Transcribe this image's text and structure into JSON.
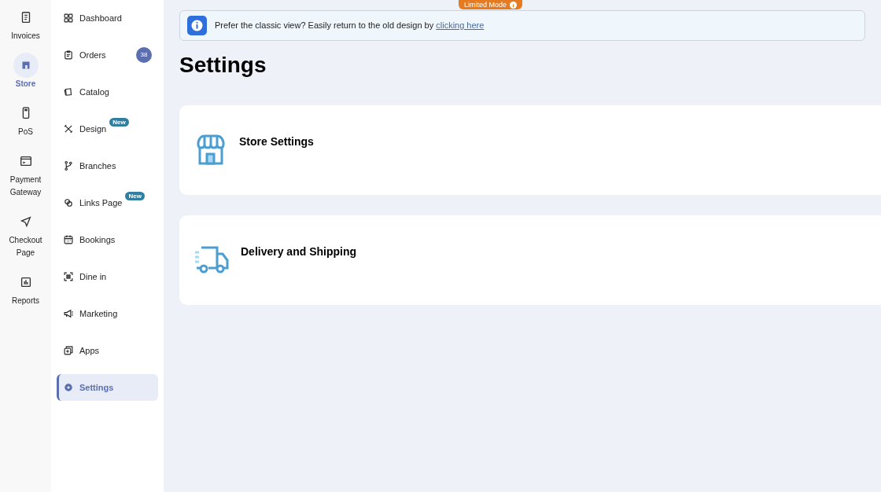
{
  "rail": [
    {
      "label": "Invoices",
      "selected": false
    },
    {
      "label": "Store",
      "selected": true
    },
    {
      "label": "PoS",
      "selected": false
    },
    {
      "label": "Payment Gateway",
      "selected": false
    },
    {
      "label": "Checkout Page",
      "selected": false
    },
    {
      "label": "Reports",
      "selected": false
    }
  ],
  "sidebar": {
    "items": [
      {
        "label": "Dashboard",
        "selected": false
      },
      {
        "label": "Orders",
        "selected": false,
        "count": "38"
      },
      {
        "label": "Catalog",
        "selected": false
      },
      {
        "label": "Design",
        "selected": false,
        "badge": "New"
      },
      {
        "label": "Branches",
        "selected": false
      },
      {
        "label": "Links Page",
        "selected": false,
        "badge": "New"
      },
      {
        "label": "Bookings",
        "selected": false
      },
      {
        "label": "Dine in",
        "selected": false
      },
      {
        "label": "Marketing",
        "selected": false
      },
      {
        "label": "Apps",
        "selected": false
      },
      {
        "label": "Settings",
        "selected": true
      }
    ]
  },
  "mode_badge": "Limited Mode",
  "banner": {
    "text": "Prefer the classic view? Easily return to the old design by",
    "link": "clicking here"
  },
  "title": "Settings",
  "cards": [
    {
      "label": "Store Settings"
    },
    {
      "label": "Delivery and Shipping"
    }
  ]
}
